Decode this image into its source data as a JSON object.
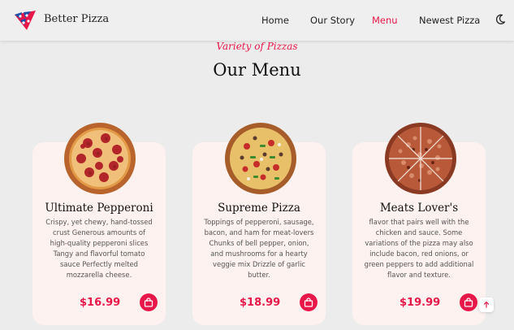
{
  "header": {
    "brand": "Better Pizza",
    "nav": [
      {
        "label": "Home"
      },
      {
        "label": "Our Story"
      },
      {
        "label": "Menu",
        "active": true
      },
      {
        "label": "Newest Pizza"
      }
    ],
    "theme_icon": "moon-icon"
  },
  "section": {
    "subtitle": "Variety of Pizzas",
    "title": "Our Menu"
  },
  "menu": [
    {
      "name": "Ultimate Pepperoni",
      "description": "Crispy, yet chewy, hand-tossed crust Generous amounts of high-quality pepperoni slices Tangy and flavorful tomato sauce Perfectly melted mozzarella cheese.",
      "price": "$16.99"
    },
    {
      "name": "Supreme Pizza",
      "description": "Toppings of pepperoni, sausage, bacon, and ham for meat-lovers Chunks of bell pepper, onion, and mushrooms for a hearty veggie mix Drizzle of garlic butter.",
      "price": "$18.99"
    },
    {
      "name": "Meats Lover's",
      "description": "flavor that pairs well with the chicken and sauce. Some variations of the pizza may also include bacon, red onions, or green peppers to add additional flavor and texture.",
      "price": "$19.99"
    }
  ],
  "colors": {
    "accent": "#e8174a",
    "card_bg": "#fdf2ef",
    "page_bg": "#ececec"
  }
}
